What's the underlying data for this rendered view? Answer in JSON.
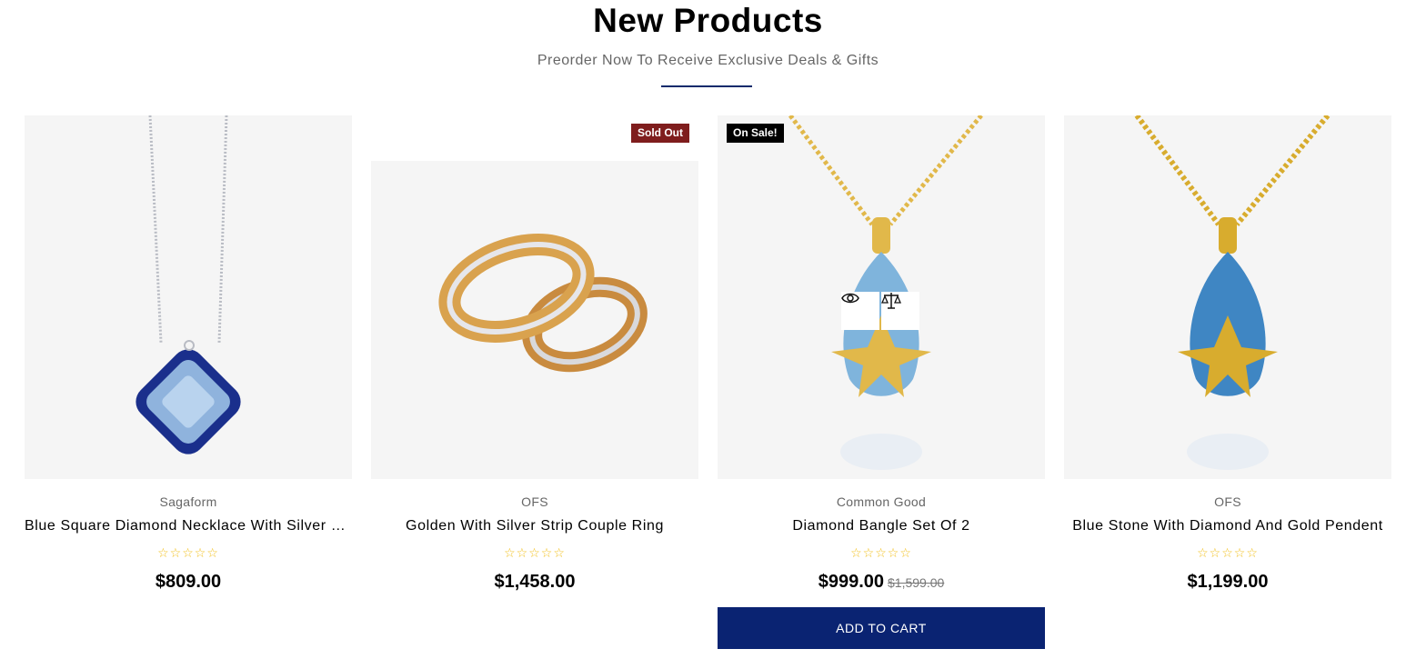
{
  "section": {
    "title": "New Products",
    "subtitle": "Preorder Now To Receive Exclusive Deals & Gifts"
  },
  "products": [
    {
      "brand": "Sagaform",
      "name": "Blue Square Diamond Necklace With Silver Chain",
      "stars": "☆☆☆☆☆",
      "price": "$809.00",
      "badge": ""
    },
    {
      "brand": "OFS",
      "name": "Golden With Silver Strip Couple Ring",
      "stars": "☆☆☆☆☆",
      "price": "$1,458.00",
      "badge": "Sold Out"
    },
    {
      "brand": "Common Good",
      "name": "Diamond Bangle Set Of 2",
      "stars": "☆☆☆☆☆",
      "price": "$999.00",
      "old_price": "$1,599.00",
      "badge": "On Sale!",
      "button": "ADD TO CART",
      "actions": [
        "eye-icon",
        "compare-icon"
      ]
    },
    {
      "brand": "OFS",
      "name": "Blue Stone With Diamond And Gold Pendent",
      "stars": "☆☆☆☆☆",
      "price": "$1,199.00",
      "badge": ""
    }
  ],
  "colors": {
    "accent": "#0a2372",
    "sold_badge": "#7f1d1d",
    "sale_badge": "#000000",
    "star": "#f2c01e"
  }
}
